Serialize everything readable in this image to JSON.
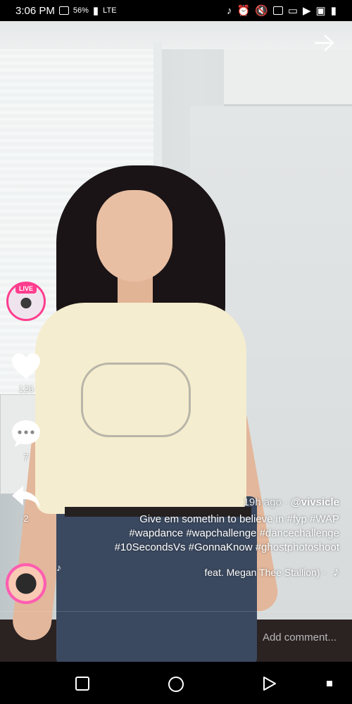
{
  "status_bar": {
    "time": "3:06 PM",
    "battery_percent": "56%",
    "network": "LTE",
    "icons": [
      "wifi-icon",
      "signal-icon",
      "vpn-icon",
      "screenshot-icon",
      "youtube-icon",
      "cast-icon",
      "calendar-icon",
      "mute-icon",
      "alarm-icon",
      "tiktok-icon"
    ]
  },
  "video": {
    "live_badge": "LIVE",
    "actions": {
      "like_count": "120",
      "comment_count": "7",
      "share_count": "2"
    },
    "caption": {
      "author": "@vivsicle",
      "separator": "·",
      "age": "19h ago",
      "description": "Give em somethin to believe in #fyp #WAP #wapdance #wapchallenge #dancechallenge #10SecondsVs #GonnaKnow #ghostphotoshoot",
      "sound": "feat. Megan Thee Stallion) ·"
    },
    "comment_placeholder": "Add comment..."
  },
  "colors": {
    "accent": "#ff3d8e",
    "text": "#ffffff",
    "placeholder": "#b8b8b8"
  }
}
